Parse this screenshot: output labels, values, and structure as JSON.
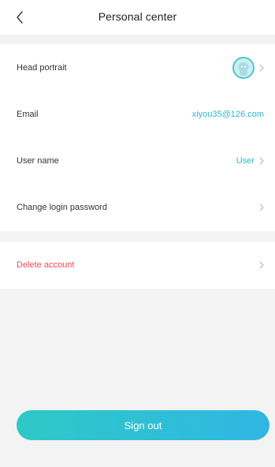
{
  "header": {
    "title": "Personal center",
    "back_icon": "chevron-left-icon"
  },
  "profile_rows": [
    {
      "label": "Head portrait",
      "value": "",
      "icon": "avatar-icon"
    },
    {
      "label": "Email",
      "value": "xiyou35@126.com"
    },
    {
      "label": "User name",
      "value": "User"
    },
    {
      "label": "Change login password",
      "value": ""
    }
  ],
  "danger_rows": [
    {
      "label": "Delete account",
      "color": "#f0494d"
    }
  ],
  "signout": {
    "label": "Sign out",
    "gradient_start": "#2ec9c6",
    "gradient_end": "#30b6e4"
  },
  "colors": {
    "accent": "#2fb8c8",
    "background": "#f3f3f4"
  }
}
